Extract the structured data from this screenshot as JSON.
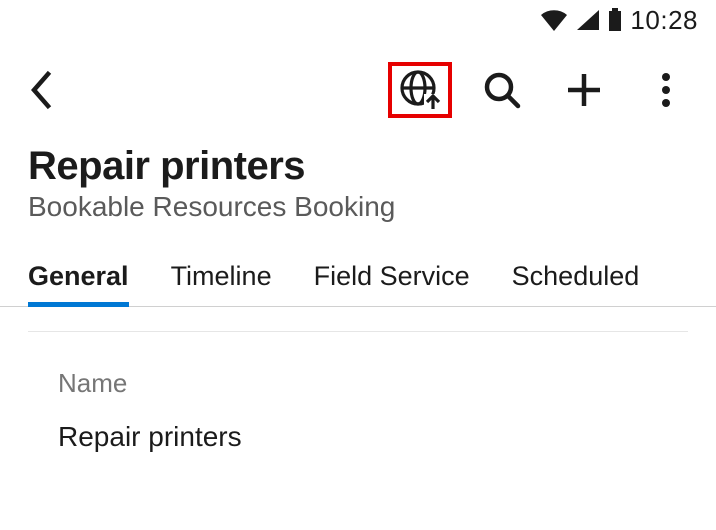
{
  "status": {
    "time": "10:28"
  },
  "header": {
    "title": "Repair printers",
    "subtitle": "Bookable Resources Booking"
  },
  "tabs": [
    {
      "label": "General",
      "active": true
    },
    {
      "label": "Timeline",
      "active": false
    },
    {
      "label": "Field Service",
      "active": false
    },
    {
      "label": "Scheduled",
      "active": false
    }
  ],
  "form": {
    "name": {
      "label": "Name",
      "value": "Repair printers"
    }
  },
  "icons": {
    "back": "back-chevron",
    "globe_upload": "globe-upload",
    "search": "search",
    "add": "add",
    "overflow": "more-vertical",
    "wifi": "wifi",
    "cell": "cellular",
    "battery": "battery-full"
  }
}
